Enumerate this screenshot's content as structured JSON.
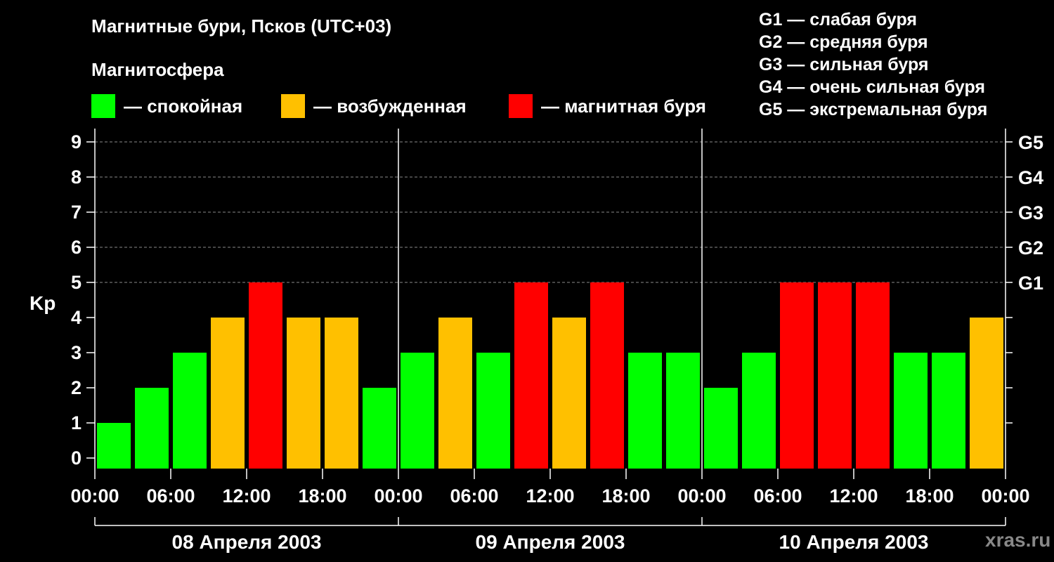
{
  "header": {
    "title": "Магнитные бури, Псков (UTC+03)",
    "subtitle": "Магнитосфера"
  },
  "legend": [
    {
      "label": "— спокойная",
      "color": "#00ff00"
    },
    {
      "label": "— возбужденная",
      "color": "#ffc000"
    },
    {
      "label": "— магнитная буря",
      "color": "#ff0000"
    }
  ],
  "g_scale": [
    "G1 — слабая буря",
    "G2 — средняя буря",
    "G3 — сильная буря",
    "G4 — очень сильная буря",
    "G5 — экстремальная буря"
  ],
  "watermark": "xras.ru",
  "colors": {
    "quiet": "#00ff00",
    "active": "#ffc000",
    "storm": "#ff0000",
    "background": "#000000",
    "foreground": "#ffffff"
  },
  "chart_data": {
    "type": "bar",
    "ylabel": "Kp",
    "ylim": [
      0,
      9
    ],
    "yticks": [
      "0",
      "1",
      "2",
      "3",
      "4",
      "5",
      "6",
      "7",
      "8",
      "9"
    ],
    "right_ticks": [
      {
        "value": 5,
        "label": "G1"
      },
      {
        "value": 6,
        "label": "G2"
      },
      {
        "value": 7,
        "label": "G3"
      },
      {
        "value": 8,
        "label": "G4"
      },
      {
        "value": 9,
        "label": "G5"
      }
    ],
    "grid": "dashed horizontal at Kp 5–9",
    "xtick_labels": [
      "00:00",
      "06:00",
      "12:00",
      "18:00",
      "00:00",
      "06:00",
      "12:00",
      "18:00",
      "00:00",
      "06:00",
      "12:00",
      "18:00",
      "00:00"
    ],
    "days": [
      "08 Апреля 2003",
      "09 Апреля 2003",
      "10 Апреля 2003"
    ],
    "values": [
      1,
      2,
      3,
      4,
      5,
      4,
      4,
      2,
      3,
      4,
      3,
      5,
      4,
      5,
      3,
      3,
      2,
      3,
      5,
      5,
      5,
      3,
      3,
      4
    ],
    "color_rule": "Kp < 4 quiet (green), Kp = 4 active (amber), Kp >= 5 storm (red)"
  }
}
